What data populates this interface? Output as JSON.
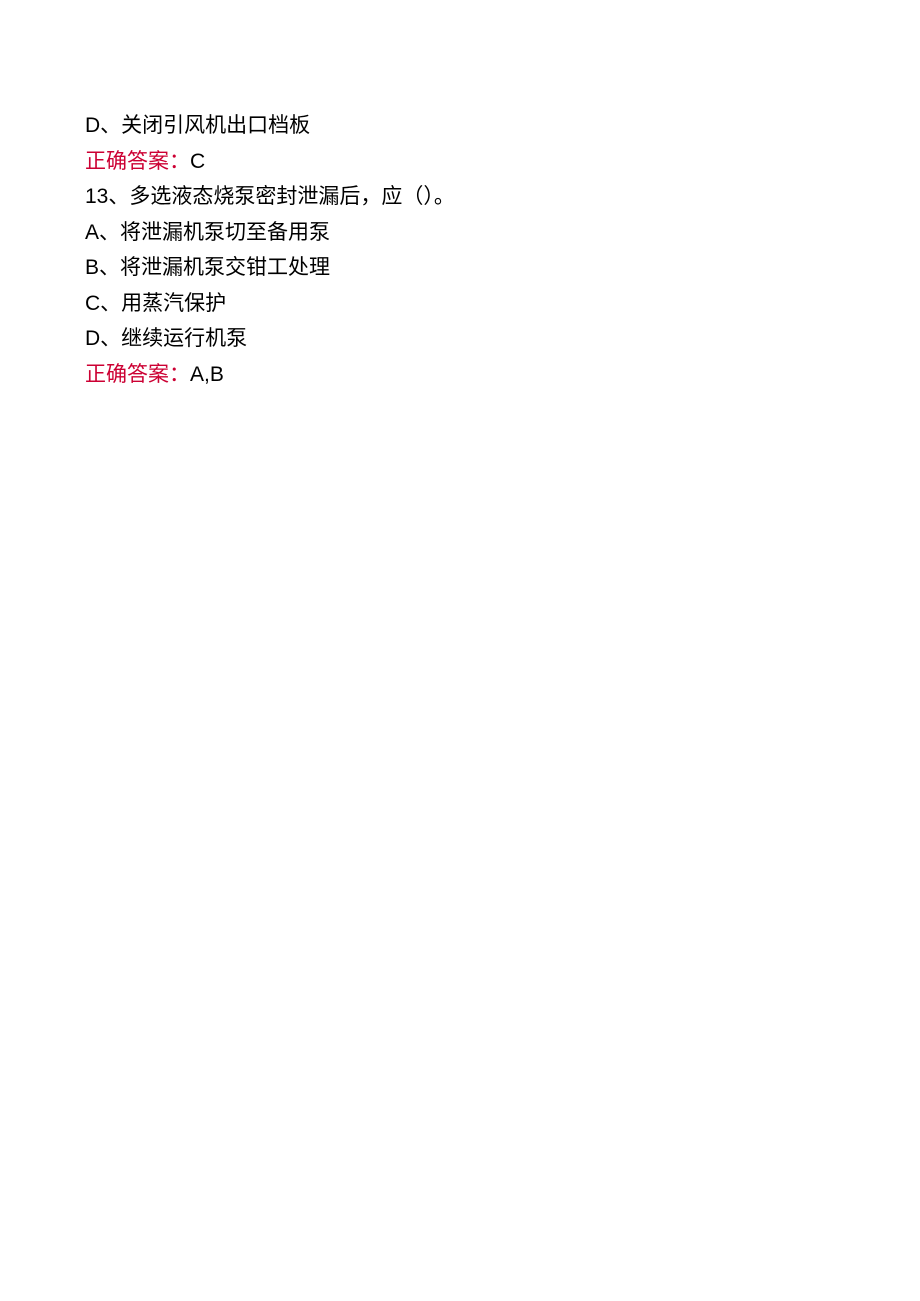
{
  "q12": {
    "optionD_letter": "D",
    "optionD_text": "、关闭引风机出口档板",
    "answer_label": "正确答案：",
    "answer_value": "C"
  },
  "q13": {
    "number": "13",
    "stem": "、多选液态烧泵密封泄漏后，应（）。",
    "optionA_letter": "A",
    "optionA_text": "、将泄漏机泵切至备用泵",
    "optionB_letter": "B",
    "optionB_text": "、将泄漏机泵交钳工处理",
    "optionC_letter": "C",
    "optionC_text": "、用蒸汽保护",
    "optionD_letter": "D",
    "optionD_text": "、继续运行机泵",
    "answer_label": "正确答案：",
    "answer_value": "A,B"
  }
}
